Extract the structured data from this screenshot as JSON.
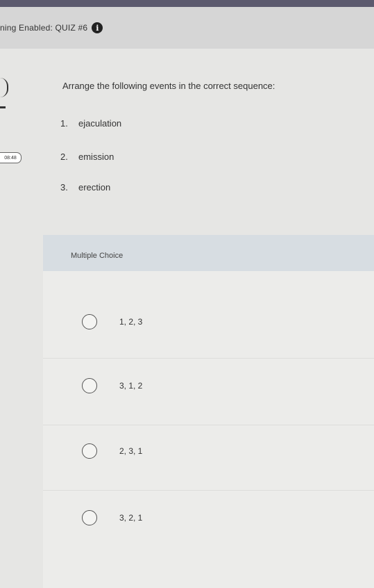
{
  "header": {
    "title": "ning Enabled: QUIZ #6",
    "info_glyph": "i"
  },
  "timer": {
    "text": "08:48"
  },
  "question": {
    "prompt": "Arrange the following events in the correct sequence:",
    "items": [
      {
        "num": "1.",
        "text": "ejaculation"
      },
      {
        "num": "2.",
        "text": "emission"
      },
      {
        "num": "3.",
        "text": "erection"
      }
    ]
  },
  "answer_block": {
    "type_label": "Multiple Choice",
    "options": [
      {
        "text": "1, 2, 3"
      },
      {
        "text": "3, 1, 2"
      },
      {
        "text": "2, 3, 1"
      },
      {
        "text": "3, 2, 1"
      }
    ]
  },
  "colors": {
    "header_bg": "#d6d6d6",
    "mc_header_bg": "#d7dde2",
    "page_bg": "#e6e6e4"
  }
}
